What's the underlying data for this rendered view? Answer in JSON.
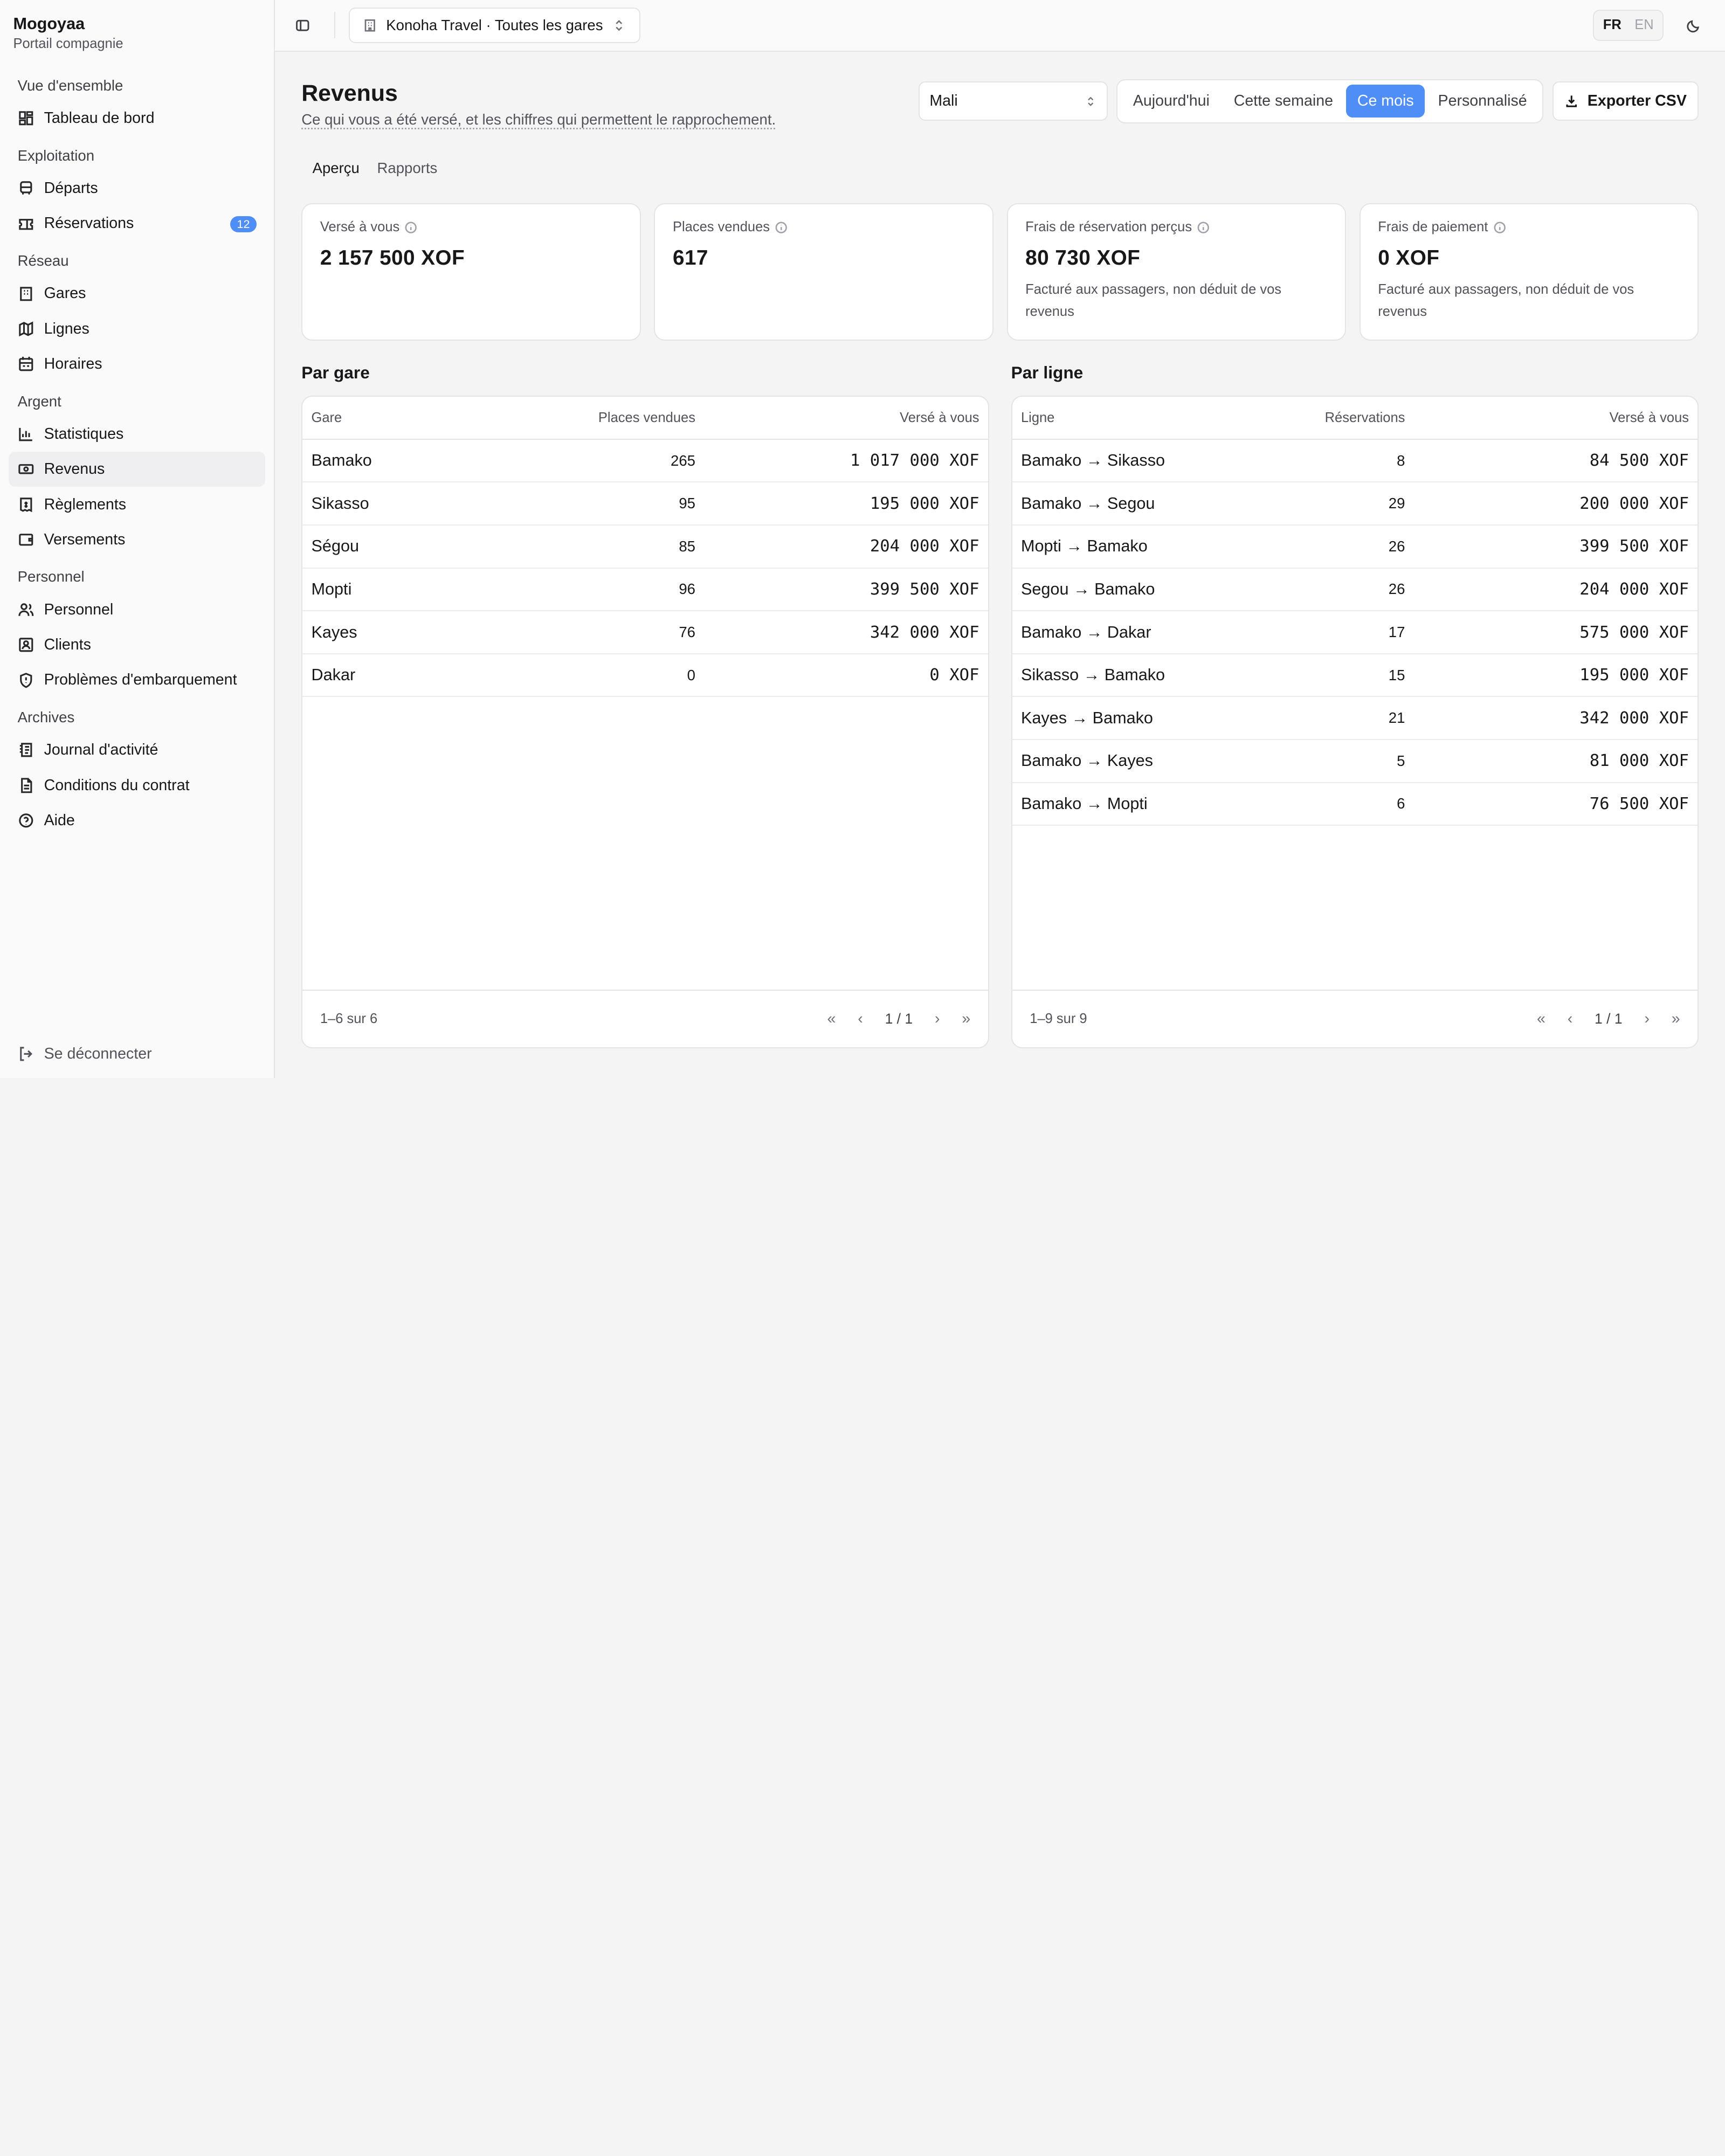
{
  "brand": {
    "name": "Mogoyaa",
    "subtitle": "Portail compagnie"
  },
  "nav": {
    "groups": [
      {
        "label": "Vue d'ensemble",
        "items": [
          {
            "label": "Tableau de bord",
            "icon": "dashboard-icon"
          }
        ]
      },
      {
        "label": "Exploitation",
        "items": [
          {
            "label": "Départs",
            "icon": "bus-icon"
          },
          {
            "label": "Réservations",
            "icon": "ticket-icon",
            "badge": "12"
          }
        ]
      },
      {
        "label": "Réseau",
        "items": [
          {
            "label": "Gares",
            "icon": "building-icon"
          },
          {
            "label": "Lignes",
            "icon": "map-icon"
          },
          {
            "label": "Horaires",
            "icon": "calendar-icon"
          }
        ]
      },
      {
        "label": "Argent",
        "items": [
          {
            "label": "Statistiques",
            "icon": "bar-chart-icon"
          },
          {
            "label": "Revenus",
            "icon": "banknote-icon",
            "active": true
          },
          {
            "label": "Règlements",
            "icon": "receipt-icon"
          },
          {
            "label": "Versements",
            "icon": "wallet-icon"
          }
        ]
      },
      {
        "label": "Personnel",
        "items": [
          {
            "label": "Personnel",
            "icon": "users-icon"
          },
          {
            "label": "Clients",
            "icon": "contact-icon"
          },
          {
            "label": "Problèmes d'embarquement",
            "icon": "shield-icon"
          }
        ]
      },
      {
        "label": "Archives",
        "items": [
          {
            "label": "Journal d'activité",
            "icon": "log-icon"
          },
          {
            "label": "Conditions du contrat",
            "icon": "document-icon"
          },
          {
            "label": "Aide",
            "icon": "help-icon"
          }
        ]
      }
    ],
    "logout": "Se déconnecter"
  },
  "topbar": {
    "company": "Konoha Travel · Toutes les gares",
    "lang_active": "FR",
    "lang_other": "EN"
  },
  "page": {
    "title": "Revenus",
    "subtitle": "Ce qui vous a été versé, et les chiffres qui permettent le rapprochement.",
    "country": "Mali",
    "periods": [
      "Aujourd'hui",
      "Cette semaine",
      "Ce mois",
      "Personnalisé"
    ],
    "active_period": "Ce mois",
    "export_label": "Exporter CSV",
    "tabs": [
      "Aperçu",
      "Rapports"
    ]
  },
  "kpis": [
    {
      "label": "Versé à vous",
      "value": "2 157 500 XOF",
      "note": ""
    },
    {
      "label": "Places vendues",
      "value": "617",
      "note": ""
    },
    {
      "label": "Frais de réservation perçus",
      "value": "80 730 XOF",
      "note": "Facturé aux passagers, non déduit de vos revenus"
    },
    {
      "label": "Frais de paiement",
      "value": "0 XOF",
      "note": "Facturé aux passagers, non déduit de vos revenus"
    }
  ],
  "by_station": {
    "title": "Par gare",
    "headers": [
      "Gare",
      "Places vendues",
      "Versé à vous"
    ],
    "rows": [
      [
        "Bamako",
        "265",
        "1 017 000 XOF"
      ],
      [
        "Sikasso",
        "95",
        "195 000 XOF"
      ],
      [
        "Ségou",
        "85",
        "204 000 XOF"
      ],
      [
        "Mopti",
        "96",
        "399 500 XOF"
      ],
      [
        "Kayes",
        "76",
        "342 000 XOF"
      ],
      [
        "Dakar",
        "0",
        "0 XOF"
      ]
    ],
    "range": "1–6 sur 6",
    "page": "1 / 1"
  },
  "by_line": {
    "title": "Par ligne",
    "headers": [
      "Ligne",
      "Réservations",
      "Versé à vous"
    ],
    "rows": [
      [
        "Bamako → Sikasso",
        "8",
        "84 500 XOF"
      ],
      [
        "Bamako → Segou",
        "29",
        "200 000 XOF"
      ],
      [
        "Mopti → Bamako",
        "26",
        "399 500 XOF"
      ],
      [
        "Segou → Bamako",
        "26",
        "204 000 XOF"
      ],
      [
        "Bamako → Dakar",
        "17",
        "575 000 XOF"
      ],
      [
        "Sikasso → Bamako",
        "15",
        "195 000 XOF"
      ],
      [
        "Kayes → Bamako",
        "21",
        "342 000 XOF"
      ],
      [
        "Bamako → Kayes",
        "5",
        "81 000 XOF"
      ],
      [
        "Bamako → Mopti",
        "6",
        "76 500 XOF"
      ]
    ],
    "range": "1–9 sur 9",
    "page": "1 / 1"
  },
  "colors": {
    "accent": "#4f8ef7",
    "border": "#e4e4e7",
    "sidebar_bg": "#fafafa"
  }
}
